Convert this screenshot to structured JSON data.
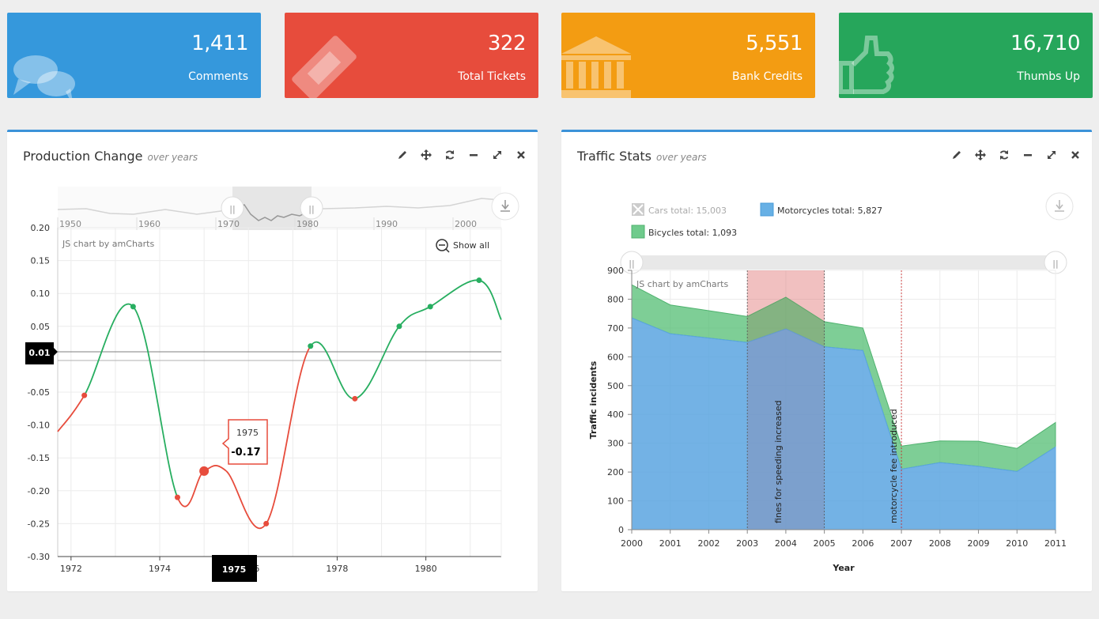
{
  "stats": [
    {
      "value": "1,411",
      "label": "Comments",
      "color": "#3598dc",
      "icon": "comments-icon"
    },
    {
      "value": "322",
      "label": "Total Tickets",
      "color": "#e7505a",
      "icon": "ticket-icon"
    },
    {
      "value": "5,551",
      "label": "Bank Credits",
      "color": "#f39c12",
      "icon": "bank-icon"
    },
    {
      "value": "16,710",
      "label": "Thumbs Up",
      "color": "#26a65b",
      "icon": "thumbs-up-icon"
    }
  ],
  "panels": {
    "production": {
      "title": "Production Change",
      "subtitle": "over years"
    },
    "traffic": {
      "title": "Traffic Stats",
      "subtitle": "over years"
    }
  },
  "production_chart": {
    "credit": "JS chart by amCharts",
    "show_all": "Show all",
    "cursor_value": "0.01",
    "cursor_category": "1975",
    "balloon": {
      "year": "1975",
      "value": "-0.17"
    },
    "scrollbar_ticks": [
      "1950",
      "1960",
      "1970",
      "1980",
      "1990",
      "2000"
    ]
  },
  "traffic_chart": {
    "credit": "JS chart by amCharts",
    "legend": [
      {
        "name": "Cars",
        "total": "total: 15,003",
        "color": "#cccccc",
        "hidden": true
      },
      {
        "name": "Motorcycles",
        "total": "total: 5,827",
        "color": "#67b0e5",
        "hidden": false
      },
      {
        "name": "Bicycles",
        "total": "total: 1,093",
        "color": "#6fcb8c",
        "hidden": false
      }
    ],
    "guides": [
      "fines for speeding increased",
      "motorcycle fee introduced"
    ]
  },
  "chart_data": [
    {
      "type": "line",
      "title": "Production Change",
      "xlabel": "",
      "ylabel": "",
      "x": [
        1971.7,
        1972.3,
        1973.4,
        1974.4,
        1975.0,
        1975.5,
        1976.4,
        1977.4,
        1978.4,
        1979.4,
        1980.1,
        1981.2,
        1981.7
      ],
      "y": [
        -0.11,
        -0.055,
        0.08,
        -0.21,
        -0.17,
        -0.17,
        -0.25,
        0.02,
        -0.06,
        0.05,
        0.08,
        0.12,
        0.06
      ],
      "xticks": [
        "1972",
        "1974",
        "1976",
        "1978",
        "1980"
      ],
      "yticks": [
        "0.20",
        "0.15",
        "0.10",
        "0.05",
        "-0.05",
        "-0.10",
        "-0.15",
        "-0.20",
        "-0.25",
        "-0.30"
      ],
      "ylim": [
        -0.3,
        0.2
      ],
      "colors": {
        "negative": "#e74c3c",
        "positive": "#27ae60"
      }
    },
    {
      "type": "area",
      "title": "Traffic Stats",
      "xlabel": "Year",
      "ylabel": "Traffic incidents",
      "categories": [
        "2000",
        "2001",
        "2002",
        "2003",
        "2004",
        "2005",
        "2006",
        "2007",
        "2008",
        "2009",
        "2010",
        "2011"
      ],
      "series": [
        {
          "name": "Motorcycles",
          "values": [
            735,
            680,
            665,
            650,
            697,
            635,
            622,
            210,
            233,
            220,
            202,
            287
          ]
        },
        {
          "name": "Bicycles",
          "values": [
            115,
            100,
            95,
            90,
            110,
            87,
            78,
            80,
            75,
            87,
            80,
            85
          ]
        }
      ],
      "stacked": true,
      "ylim": [
        0,
        900
      ],
      "yticks": [
        "0",
        "100",
        "200",
        "300",
        "400",
        "500",
        "600",
        "700",
        "800",
        "900"
      ],
      "guides": [
        {
          "from": "2003",
          "to": "2005",
          "label": "fines for speeding increased"
        },
        {
          "at": "2007",
          "label": "motorcycle fee introduced"
        }
      ]
    }
  ]
}
